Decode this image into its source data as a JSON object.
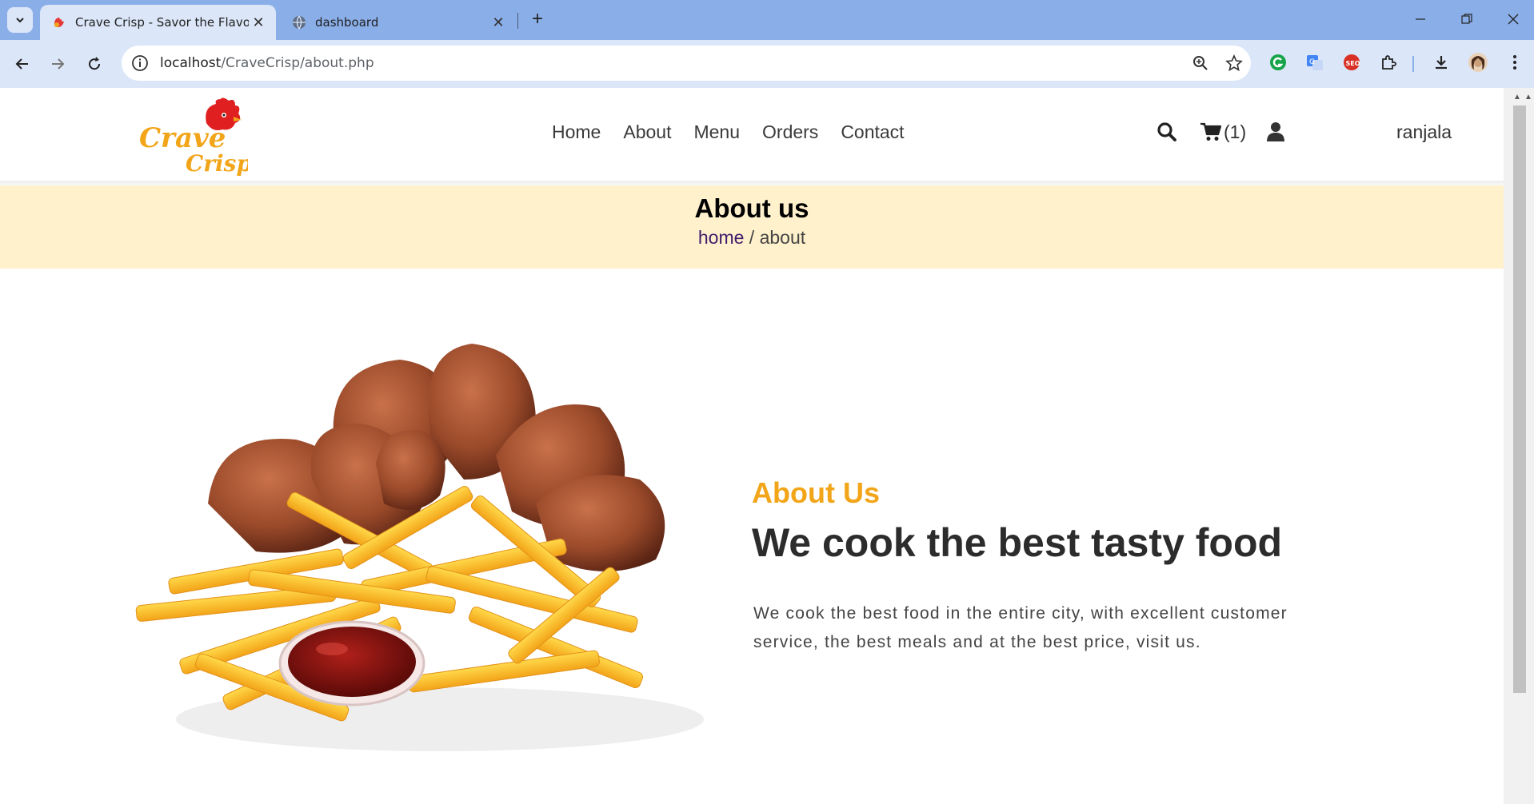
{
  "browser": {
    "tabs": [
      {
        "title": "Crave Crisp - Savor the Flavors",
        "active": true
      },
      {
        "title": "dashboard",
        "active": false
      }
    ],
    "url_host": "localhost",
    "url_path": "/CraveCrisp/about.php"
  },
  "header": {
    "logo_text_1": "Crave",
    "logo_text_2": "Crisp",
    "nav": [
      "Home",
      "About",
      "Menu",
      "Orders",
      "Contact"
    ],
    "cart_count": "(1)",
    "username": "ranjala"
  },
  "banner": {
    "title": "About us",
    "crumb_home": "home",
    "crumb_sep": " / ",
    "crumb_current": "about"
  },
  "about": {
    "subtitle": "About Us",
    "title": "We cook the best tasty food",
    "text": "We cook the best food in the entire city, with excellent customer service, the best meals and at the best price, visit us."
  },
  "colors": {
    "accent": "#f2a518",
    "banner_bg": "#fff1cc",
    "chrome_tabbar": "#8aaee8",
    "chrome_toolbar": "#dbe6f8"
  }
}
